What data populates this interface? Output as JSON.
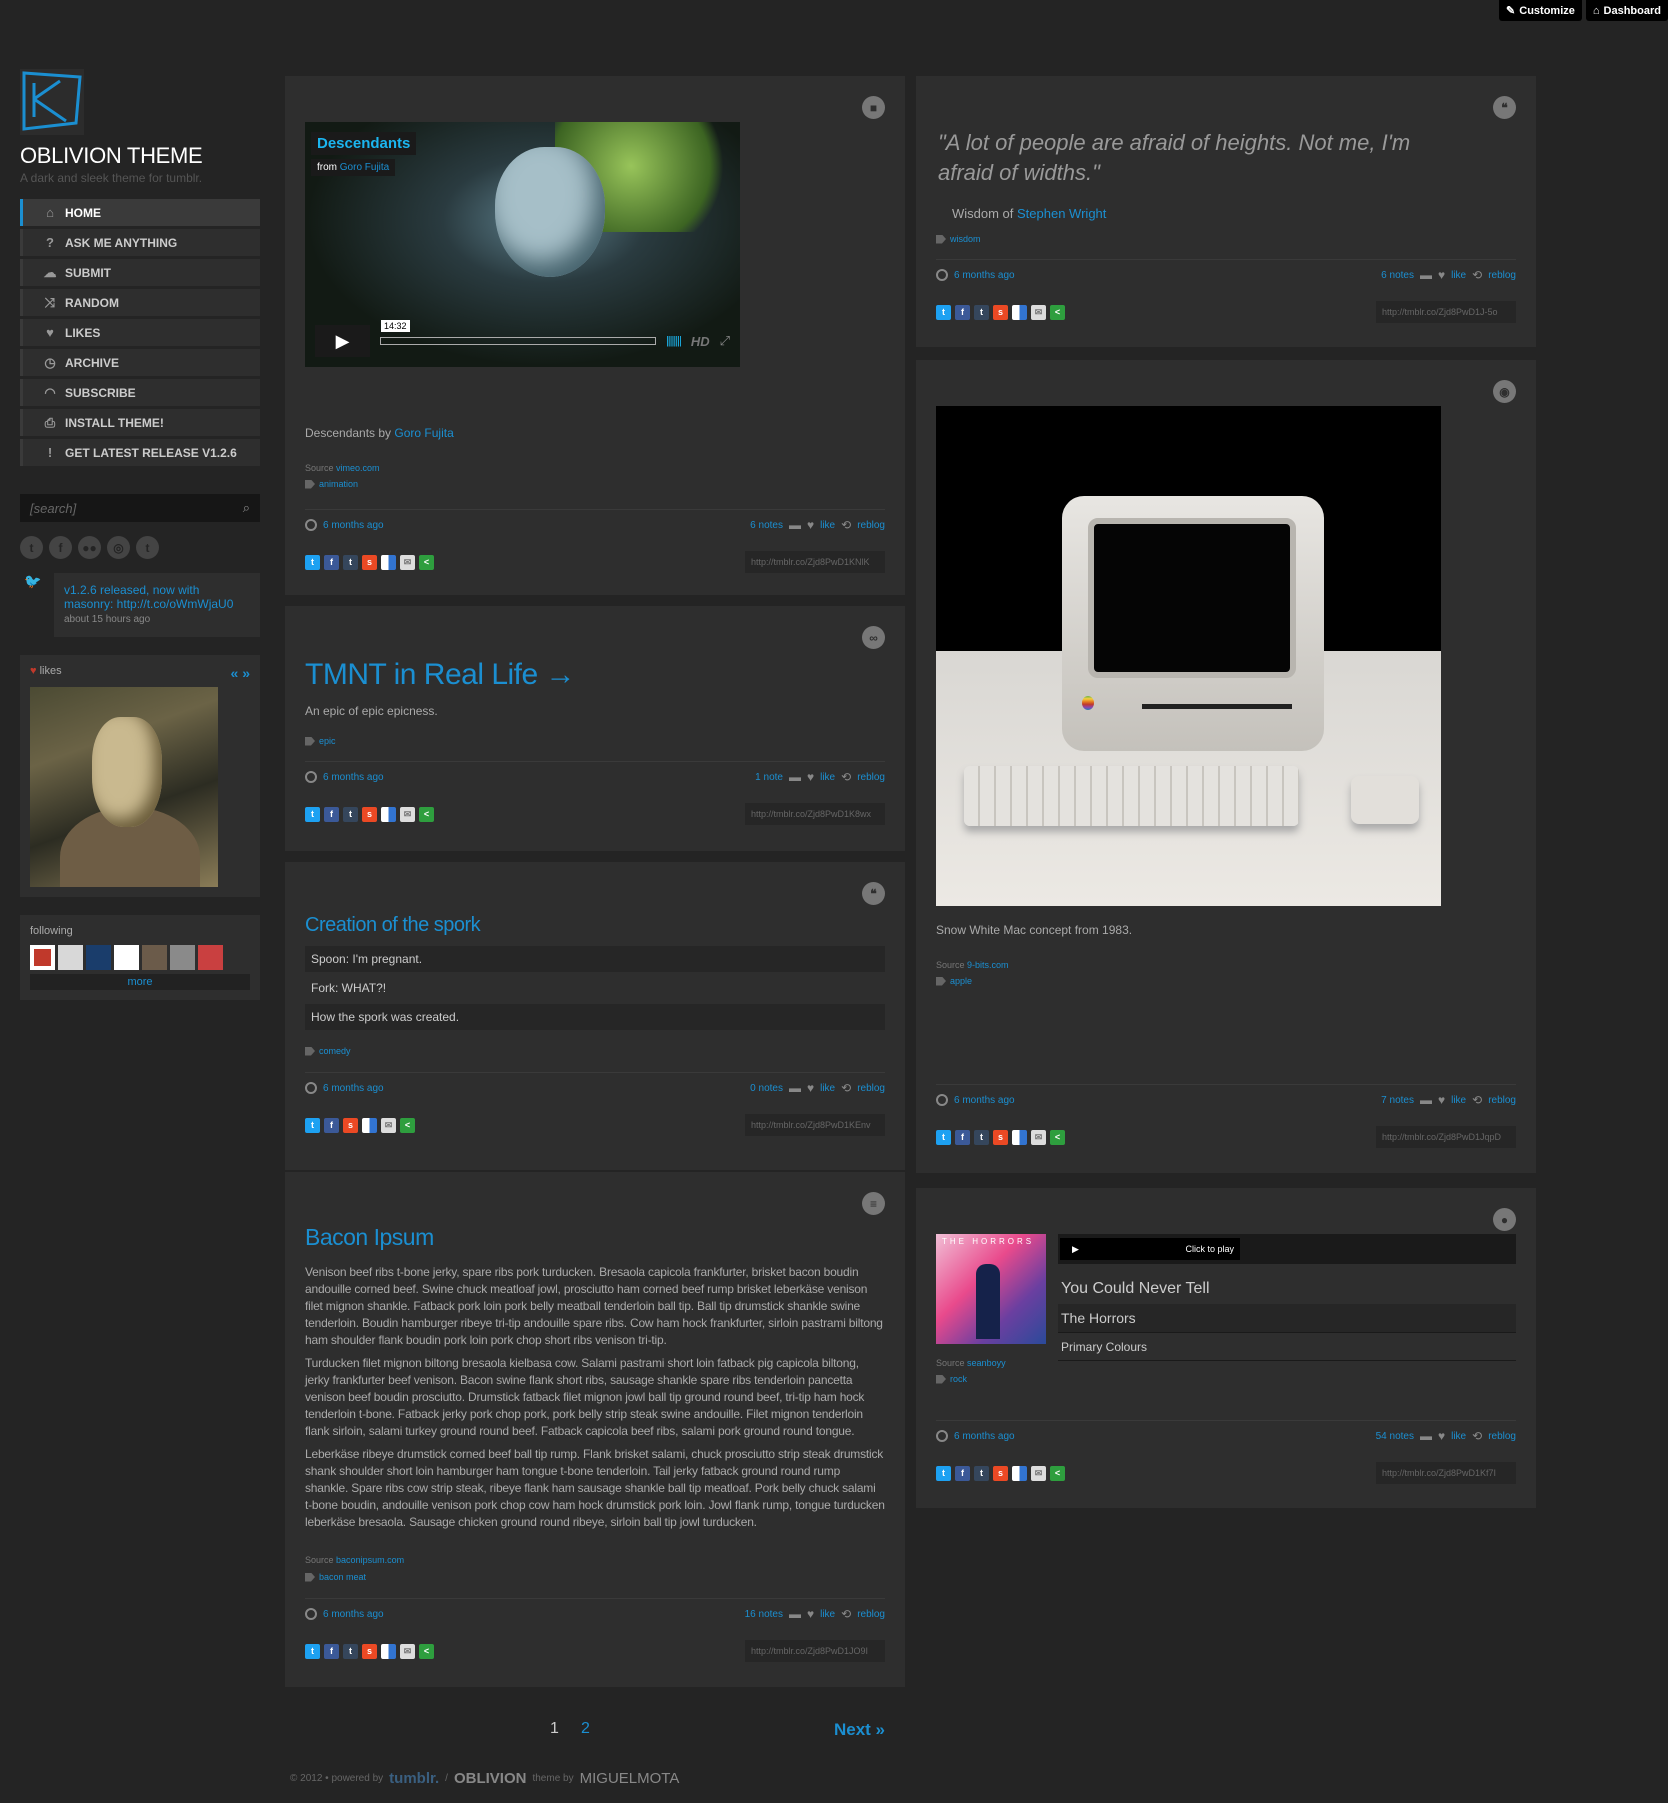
{
  "topbar": {
    "customize": "Customize",
    "dashboard": "Dashboard"
  },
  "sidebar": {
    "title": "OBLIVION THEME",
    "description": "A dark and sleek theme for tumblr.",
    "nav": [
      {
        "label": "HOME",
        "icon": "home-icon"
      },
      {
        "label": "ASK ME ANYTHING",
        "icon": "question-icon"
      },
      {
        "label": "SUBMIT",
        "icon": "cloud-upload-icon"
      },
      {
        "label": "RANDOM",
        "icon": "shuffle-icon"
      },
      {
        "label": "LIKES",
        "icon": "heart-icon"
      },
      {
        "label": "ARCHIVE",
        "icon": "clock-icon"
      },
      {
        "label": "SUBSCRIBE",
        "icon": "rss-icon"
      },
      {
        "label": "INSTALL THEME!",
        "icon": "download-icon"
      },
      {
        "label": "GET LATEST RELEASE V1.2.6",
        "icon": "alert-icon"
      }
    ],
    "search_placeholder": "[search]",
    "tweet": {
      "text": "v1.2.6 released, now with masonry: http://t.co/oWmWjaU0",
      "time": "about 15 hours ago"
    },
    "likes_title": "likes",
    "likes_nav": "« »",
    "following_title": "following",
    "following_more": "more"
  },
  "posts": {
    "video": {
      "video_title": "Descendants",
      "video_from": "from",
      "video_author": "Goro Fujita",
      "time": "14:32",
      "hd": "HD",
      "caption_prefix": "Descendants by ",
      "caption_link": "Goro Fujita",
      "source_label": "Source",
      "source": "vimeo.com",
      "tag": "animation",
      "ago": "6 months ago",
      "notes": "6 notes",
      "like": "like",
      "reblog": "reblog",
      "short_url": "http://tmblr.co/Zjd8PwD1KNlK"
    },
    "link": {
      "title": "TMNT in Real Life →",
      "desc": "An epic of epic epicness.",
      "tag": "epic",
      "ago": "6 months ago",
      "notes": "1 note",
      "like": "like",
      "reblog": "reblog",
      "short_url": "http://tmblr.co/Zjd8PwD1K8wx"
    },
    "chat": {
      "title": "Creation of the spork",
      "lines": [
        "Spoon: I'm pregnant.",
        "Fork: WHAT?!",
        "How the spork was created."
      ],
      "tag": "comedy",
      "ago": "6 months ago",
      "notes": "0 notes",
      "like": "like",
      "reblog": "reblog",
      "short_url": "http://tmblr.co/Zjd8PwD1KEnv"
    },
    "text": {
      "title": "Bacon Ipsum",
      "paragraphs": [
        "Venison beef ribs t-bone jerky, spare ribs pork turducken. Bresaola capicola frankfurter, brisket bacon boudin andouille corned beef. Swine chuck meatloaf jowl, prosciutto ham corned beef rump brisket leberkäse venison filet mignon shankle. Fatback pork loin pork belly meatball tenderloin ball tip. Ball tip drumstick shankle swine tenderloin. Boudin hamburger ribeye tri-tip andouille spare ribs. Cow ham hock frankfurter, sirloin pastrami biltong ham shoulder flank boudin pork loin pork chop short ribs venison tri-tip.",
        "Turducken filet mignon biltong bresaola kielbasa cow. Salami pastrami short loin fatback pig capicola biltong, jerky frankfurter beef venison. Bacon swine flank short ribs, sausage shankle spare ribs tenderloin pancetta venison beef boudin prosciutto. Drumstick fatback filet mignon jowl ball tip ground round beef, tri-tip ham hock tenderloin t-bone. Fatback jerky pork chop pork, pork belly strip steak swine andouille. Filet mignon tenderloin flank sirloin, salami turkey ground round beef. Fatback capicola beef ribs, salami pork ground round tongue.",
        "Leberkäse ribeye drumstick corned beef ball tip rump. Flank brisket salami, chuck prosciutto strip steak drumstick shank shoulder short loin hamburger ham tongue t-bone tenderloin. Tail jerky fatback ground round rump shankle. Spare ribs cow strip steak, ribeye flank ham sausage shankle ball tip meatloaf. Pork belly chuck salami t-bone boudin, andouille venison pork chop cow ham hock drumstick pork loin. Jowl flank rump, tongue turducken leberkäse bresaola. Sausage chicken ground round ribeye, sirloin ball tip jowl turducken."
      ],
      "source_label": "Source",
      "source": "baconipsum.com",
      "tag": "bacon meat",
      "ago": "6 months ago",
      "notes": "16 notes",
      "like": "like",
      "reblog": "reblog",
      "short_url": "http://tmblr.co/Zjd8PwD1JO9I"
    },
    "quote": {
      "text": "\"A lot of people are afraid of heights. Not me, I'm afraid of widths.\"",
      "source_prefix": "Wisdom of ",
      "source_link": "Stephen Wright",
      "tag": "wisdom",
      "ago": "6 months ago",
      "notes": "6 notes",
      "like": "like",
      "reblog": "reblog",
      "short_url": "http://tmblr.co/Zjd8PwD1J-5o"
    },
    "photo": {
      "caption": "Snow White Mac concept from 1983.",
      "source_label": "Source",
      "source": "9-bits.com",
      "tag": "apple",
      "ago": "6 months ago",
      "notes": "7 notes",
      "like": "like",
      "reblog": "reblog",
      "short_url": "http://tmblr.co/Zjd8PwD1JqpD"
    },
    "audio": {
      "album_text": "THE HORRORS",
      "click": "Click to play",
      "track": "You Could Never Tell",
      "artist": "The Horrors",
      "album": "Primary Colours",
      "source_label": "Source",
      "source": "seanboyy",
      "tag": "rock",
      "ago": "6 months ago",
      "notes": "54 notes",
      "like": "like",
      "reblog": "reblog",
      "short_url": "http://tmblr.co/Zjd8PwD1Kf7I"
    }
  },
  "pagination": {
    "page1": "1",
    "page2": "2",
    "next": "Next »"
  },
  "footer": {
    "copy": "© 2012 • powered by",
    "tumblr": "tumblr.",
    "sep": "/",
    "oblivion": "OBLIVION",
    "by": "theme by",
    "author": "MIGUELMOTA"
  }
}
